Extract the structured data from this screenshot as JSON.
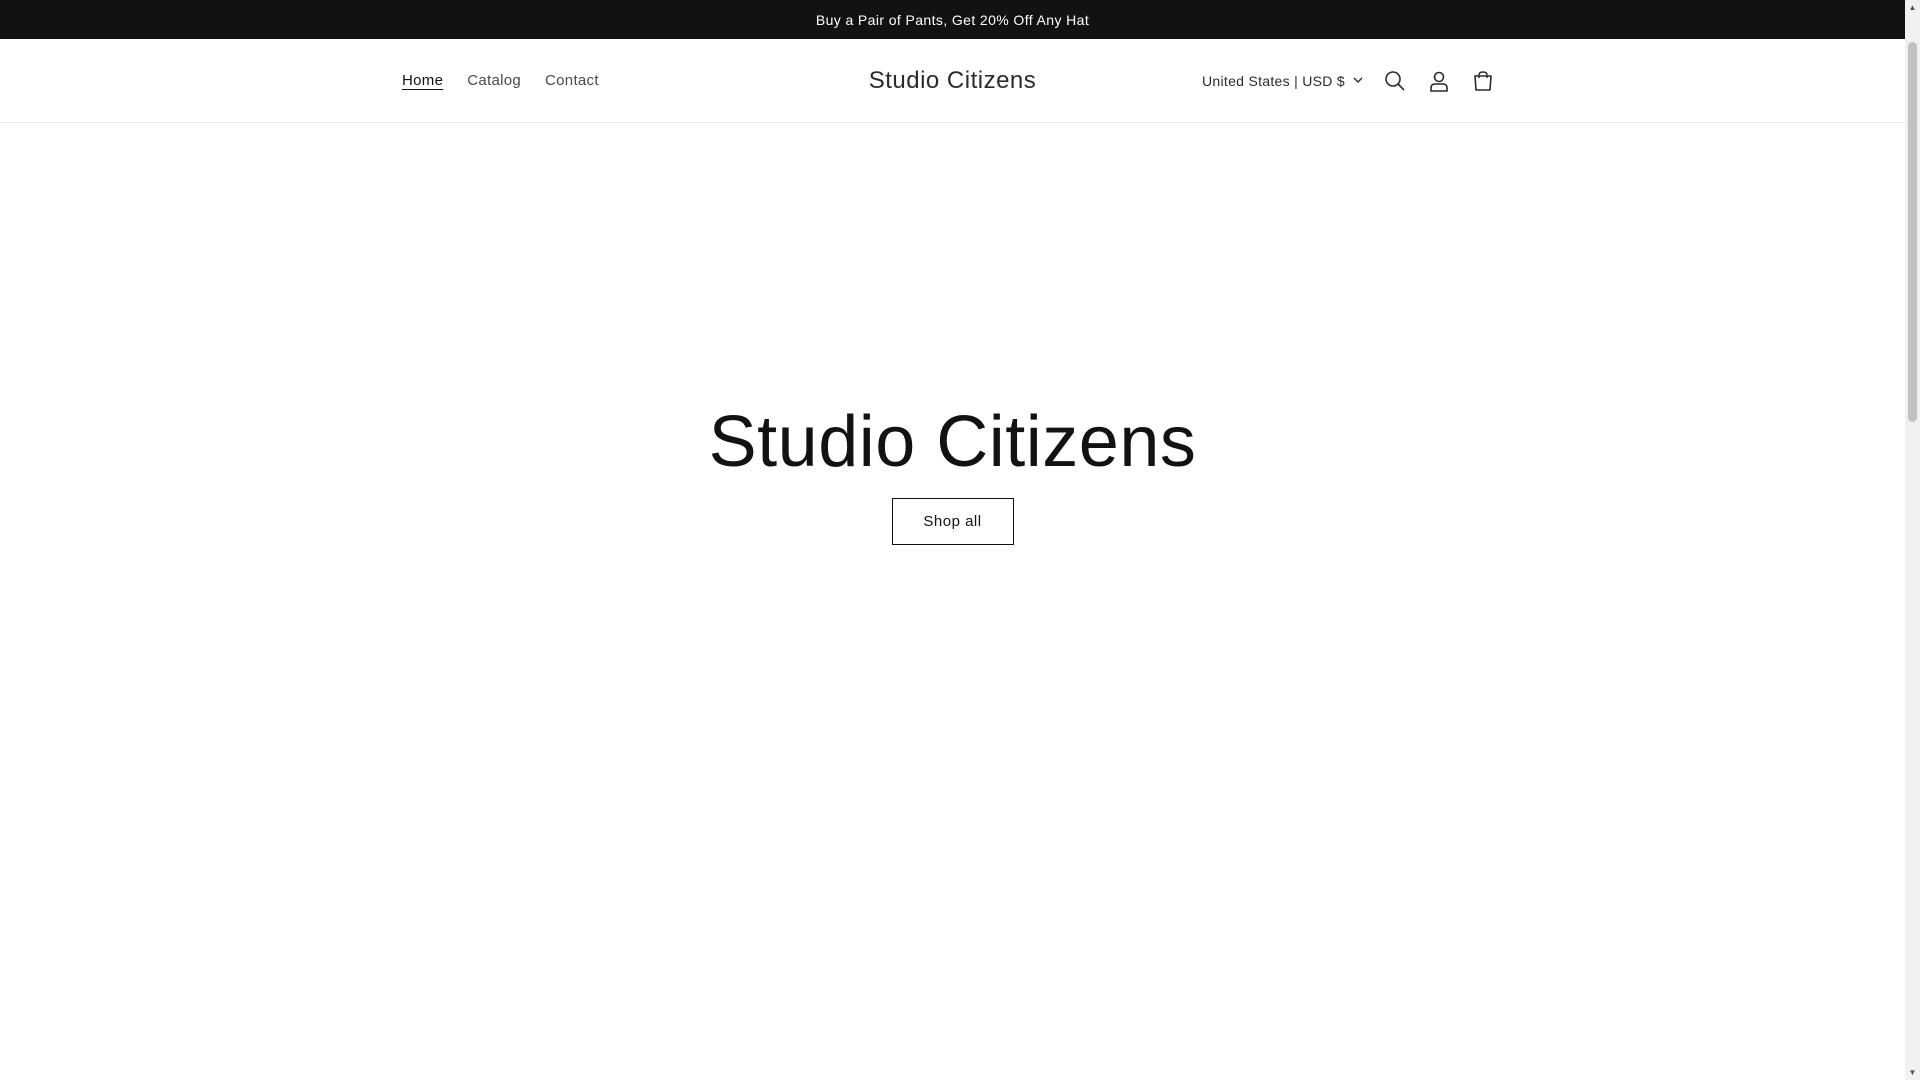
{
  "announcement": {
    "text": "Buy a Pair of Pants, Get 20% Off Any Hat"
  },
  "header": {
    "nav": [
      {
        "label": "Home",
        "active": true
      },
      {
        "label": "Catalog",
        "active": false
      },
      {
        "label": "Contact",
        "active": false
      }
    ],
    "logo": "Studio Citizens",
    "country_selector": "United States | USD $",
    "icons": [
      "search-icon",
      "account-icon",
      "cart-icon"
    ]
  },
  "hero": {
    "title": "Studio Citizens",
    "button_label": "Shop all"
  },
  "colors": {
    "announcement_bg": "#121212",
    "text": "#121212",
    "background": "#ffffff"
  }
}
